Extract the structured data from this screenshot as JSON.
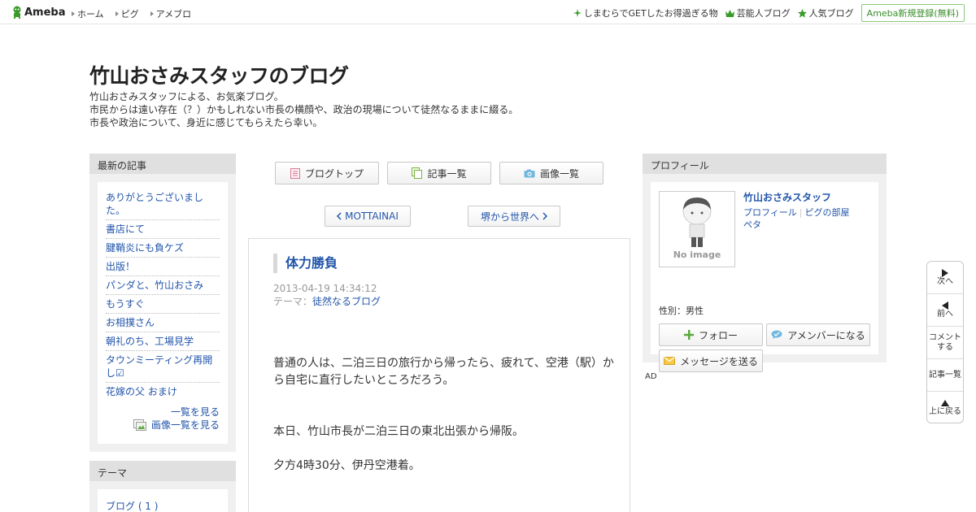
{
  "topbar": {
    "logo_text": "Ameba",
    "nav": [
      "ホーム",
      "ピグ",
      "アメブロ"
    ],
    "right_links": [
      "しまむらでGETしたお得過ぎる物",
      "芸能人ブログ",
      "人気ブログ"
    ],
    "register_label": "Ameba新規登録(無料)"
  },
  "header": {
    "title": "竹山おさみスタッフのブログ",
    "desc_lines": [
      "竹山おさみスタッフによる、お気楽ブログ。",
      "市民からは遠い存在（？）かもしれない市長の横顔や、政治の現場について徒然なるままに綴る。",
      "市長や政治について、身近に感じてもらえたら幸い。"
    ]
  },
  "sidebar_left": {
    "latest_heading": "最新の記事",
    "articles": [
      "ありがとうございました。",
      "書店にて",
      "腱鞘炎にも負ケズ",
      "出版！",
      "パンダと、竹山おさみ",
      "もうすぐ",
      "お相撲さん",
      "朝礼のち、工場見学",
      "タウンミーティング再開し☑",
      "花嫁の父 おまけ"
    ],
    "see_list": "一覧を見る",
    "see_images": "画像一覧を見る",
    "theme_heading": "テーマ",
    "theme_item": "ブログ ( 1 )"
  },
  "main": {
    "nav_buttons": [
      "ブログトップ",
      "記事一覧",
      "画像一覧"
    ],
    "prev_label": "MOTTAINAI",
    "next_label": "堺から世界へ",
    "entry": {
      "title": "体力勝負",
      "date": "2013-04-19 14:34:12",
      "theme_prefix": "テーマ：",
      "theme": "徒然なるブログ",
      "paragraphs": [
        "普通の人は、二泊三日の旅行から帰ったら、疲れて、空港（駅）から自宅に直行したいところだろう。",
        "本日、竹山市長が二泊三日の東北出張から帰阪。",
        "夕方4時30分、伊丹空港着。"
      ]
    }
  },
  "profile": {
    "heading": "プロフィール",
    "name": "竹山おさみスタッフ",
    "noimage": "No image",
    "link_profile": "プロフィール",
    "link_pig": "ピグの部屋",
    "link_peta": "ペタ",
    "gender": "性別：男性",
    "follow": "フォロー",
    "amember": "アメンバーになる",
    "message": "メッセージを送る"
  },
  "ad_label": "AD",
  "sidenav": {
    "next": "次へ",
    "prev": "前へ",
    "comment": "コメントする",
    "list": "記事一覧",
    "top": "上に戻る"
  },
  "colors": {
    "link": "#2255aa",
    "ameba_green": "#3a8e2a",
    "header_gray": "#e0e0e0"
  }
}
